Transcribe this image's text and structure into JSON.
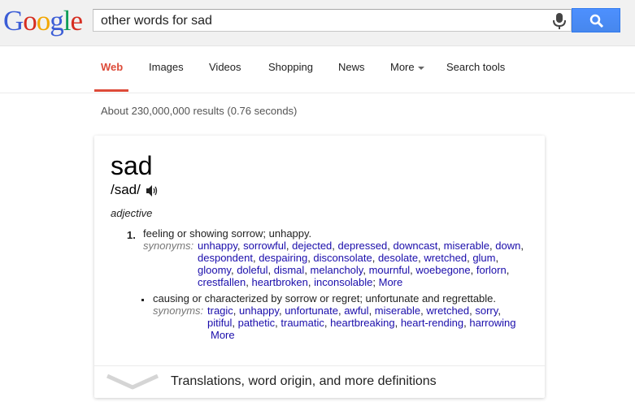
{
  "logo": {
    "letters": [
      "G",
      "o",
      "o",
      "g",
      "l",
      "e"
    ],
    "colors": [
      "#3b5dd6",
      "#d62d20",
      "#f2a600",
      "#3b5dd6",
      "#109d59",
      "#d62d20"
    ]
  },
  "search": {
    "query": "other words for sad"
  },
  "tabs": [
    {
      "label": "Web",
      "active": true
    },
    {
      "label": "Images"
    },
    {
      "label": "Videos"
    },
    {
      "label": "Shopping"
    },
    {
      "label": "News"
    },
    {
      "label": "More"
    },
    {
      "label": "Search tools"
    }
  ],
  "results_count": "About 230,000,000 results (0.76 seconds)",
  "definition": {
    "word": "sad",
    "phonetic": "/sad/",
    "part_of_speech": "adjective",
    "sense1": {
      "number": "1.",
      "text": "feeling or showing sorrow; unhappy.",
      "synonyms_label": "synonyms:",
      "lines": [
        [
          "unhappy",
          "sorrowful",
          "dejected",
          "depressed",
          "downcast",
          "miserable",
          "down"
        ],
        [
          "despondent",
          "despairing",
          "disconsolate",
          "desolate",
          "wretched",
          "glum"
        ],
        [
          "gloomy",
          "doleful",
          "dismal",
          "melancholy",
          "mournful",
          "woebegone",
          "forlorn"
        ],
        [
          "crestfallen",
          "heartbroken",
          "inconsolable"
        ]
      ],
      "more_label": "More"
    },
    "sense2": {
      "text": "causing or characterized by sorrow or regret; unfortunate and regrettable.",
      "synonyms_label": "synonyms:",
      "lines": [
        [
          "tragic",
          "unhappy",
          "unfortunate",
          "awful",
          "miserable",
          "wretched",
          "sorry"
        ],
        [
          "pitiful",
          "pathetic",
          "traumatic",
          "heartbreaking",
          "heart-rending",
          "harrowing"
        ]
      ],
      "more_label": "More"
    },
    "footer_label": "Translations, word origin, and more definitions"
  },
  "icon_names": [
    "microphone-icon",
    "search-icon",
    "speaker-icon",
    "chevron-down-icon"
  ]
}
